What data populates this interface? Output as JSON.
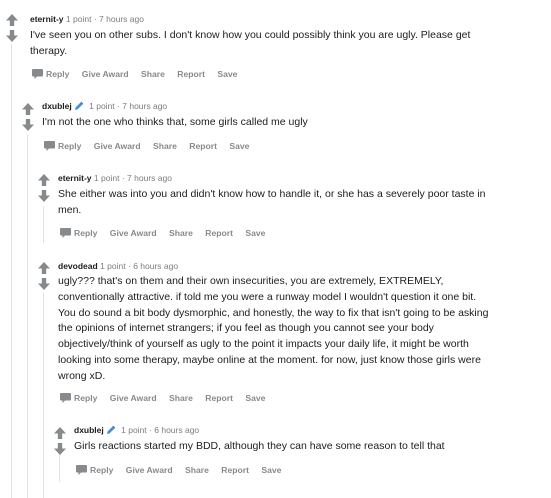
{
  "colors": {
    "text": "#1c1c1c",
    "meta": "#7c7c7c",
    "action": "#878a8c",
    "vote_arrow": "#878a8c",
    "flair": "#4a90d9",
    "thread_line": "#e3e3e3"
  },
  "actions": {
    "reply": "Reply",
    "give_award": "Give Award",
    "share": "Share",
    "report": "Report",
    "save": "Save"
  },
  "comments": [
    {
      "author": "eternit-y",
      "points": "1 point",
      "separator": "·",
      "time": "7 hours ago",
      "flair_icon": "",
      "lines": [
        "I've seen you on other subs. I don't know how you could possibly think you are ugly. Please get",
        "therapy."
      ]
    },
    {
      "author": "dxublej",
      "points": "1 point",
      "separator": "·",
      "time": "7 hours ago",
      "flair_icon": "pencil-icon",
      "lines": [
        "I'm not the one who thinks that, some girls called me ugly"
      ]
    },
    {
      "author": "eternit-y",
      "points": "1 point",
      "separator": "·",
      "time": "7 hours ago",
      "flair_icon": "",
      "lines": [
        "She either was into you and didn't know how to handle it, or she has a severely poor taste in",
        "men."
      ]
    },
    {
      "author": "devodead",
      "points": "1 point",
      "separator": "·",
      "time": "6 hours ago",
      "flair_icon": "",
      "lines": [
        "ugly??? that's on them and their own insecurities, you are extremely, EXTREMELY,",
        "conventionally attractive. if told me you were a runway model I wouldn't question it one bit.",
        "You do sound a bit body dysmorphic, and honestly, the way to fix that isn't going to be asking",
        "the opinions of internet strangers; if you feel as though you cannot see your body",
        "objectively/think of yourself as ugly to the point it impacts your daily life, it might be worth",
        "looking into some therapy, maybe online at the moment. for now, just know those girls were",
        "wrong xD."
      ]
    },
    {
      "author": "dxublej",
      "points": "1 point",
      "separator": "·",
      "time": "6 hours ago",
      "flair_icon": "pencil-icon",
      "lines": [
        "Girls reactions started my BDD, although they can have some reason to tell that"
      ]
    }
  ]
}
